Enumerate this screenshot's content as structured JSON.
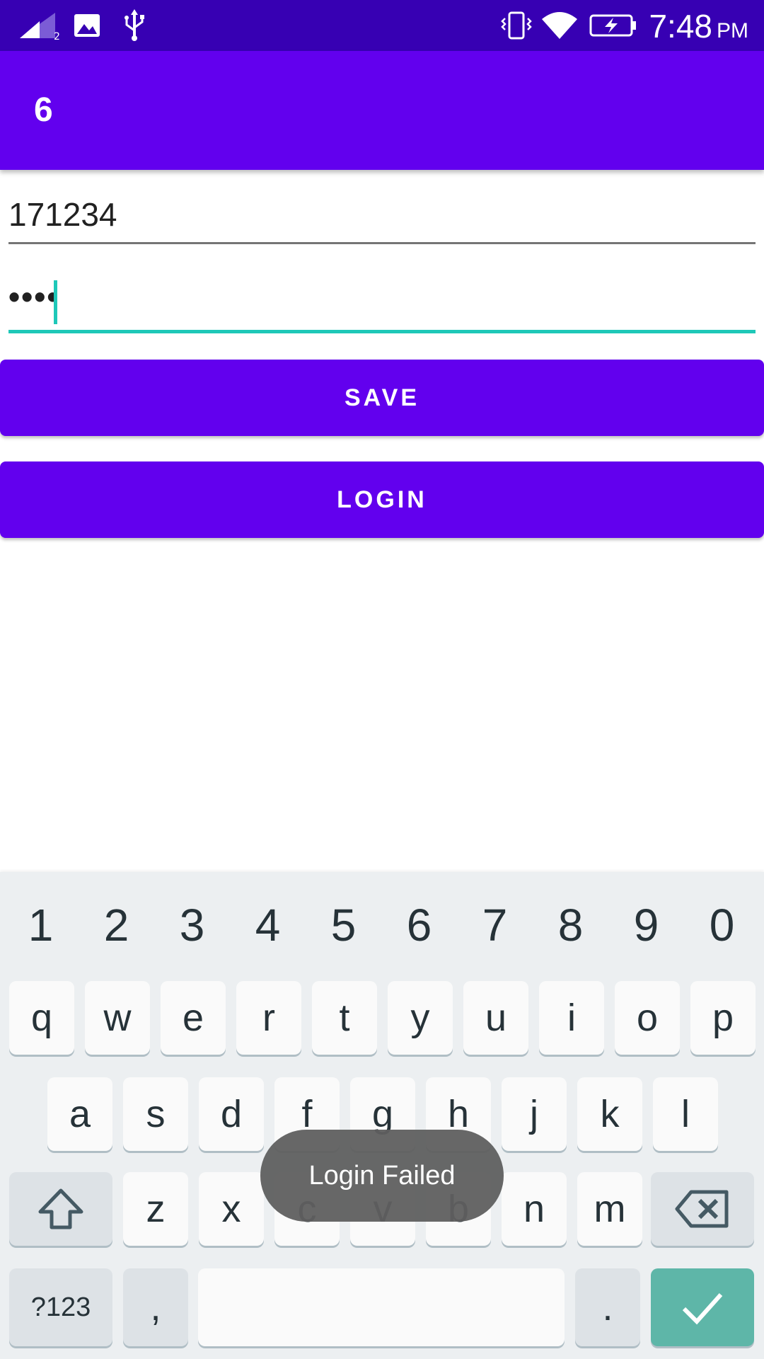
{
  "status_bar": {
    "time": "7:48",
    "ampm": "PM",
    "icons": [
      "signal-icon",
      "image-icon",
      "usb-icon",
      "vibrate-icon",
      "wifi-icon",
      "battery-charging-icon"
    ],
    "signal_sub": "2"
  },
  "app_bar": {
    "title": "6"
  },
  "form": {
    "username_value": "171234",
    "password_value": "••••"
  },
  "buttons": {
    "save": "SAVE",
    "login": "LOGIN"
  },
  "keyboard": {
    "numbers": [
      "1",
      "2",
      "3",
      "4",
      "5",
      "6",
      "7",
      "8",
      "9",
      "0"
    ],
    "row1": [
      "q",
      "w",
      "e",
      "r",
      "t",
      "y",
      "u",
      "i",
      "o",
      "p"
    ],
    "row2": [
      "a",
      "s",
      "d",
      "f",
      "g",
      "h",
      "j",
      "k",
      "l"
    ],
    "row3": [
      "z",
      "x",
      "c",
      "v",
      "b",
      "n",
      "m"
    ],
    "symbols_key": "?123",
    "comma_key": ",",
    "period_key": "."
  },
  "toast": {
    "message": "Login Failed"
  },
  "colors": {
    "status_bar": "#3700b3",
    "primary": "#6200ee",
    "accent": "#1ec8b8",
    "keyboard_bg": "#eceff1",
    "enter_key": "#5eb6a8"
  }
}
